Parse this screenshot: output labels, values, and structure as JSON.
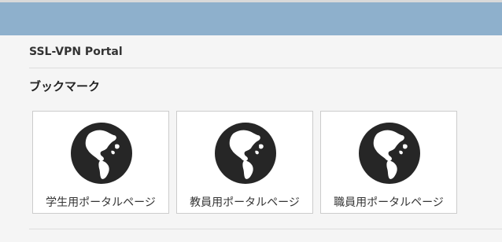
{
  "header": {
    "portal_title": "SSL-VPN Portal"
  },
  "bookmarks": {
    "heading": "ブックマーク",
    "items": [
      {
        "label": "学生用ポータルページ",
        "icon": "globe-icon"
      },
      {
        "label": "教員用ポータルページ",
        "icon": "globe-icon"
      },
      {
        "label": "職員用ポータルページ",
        "icon": "globe-icon"
      }
    ]
  },
  "colors": {
    "topbar": "#8eb0cc",
    "globe": "#262626",
    "background": "#f5f5f5"
  }
}
